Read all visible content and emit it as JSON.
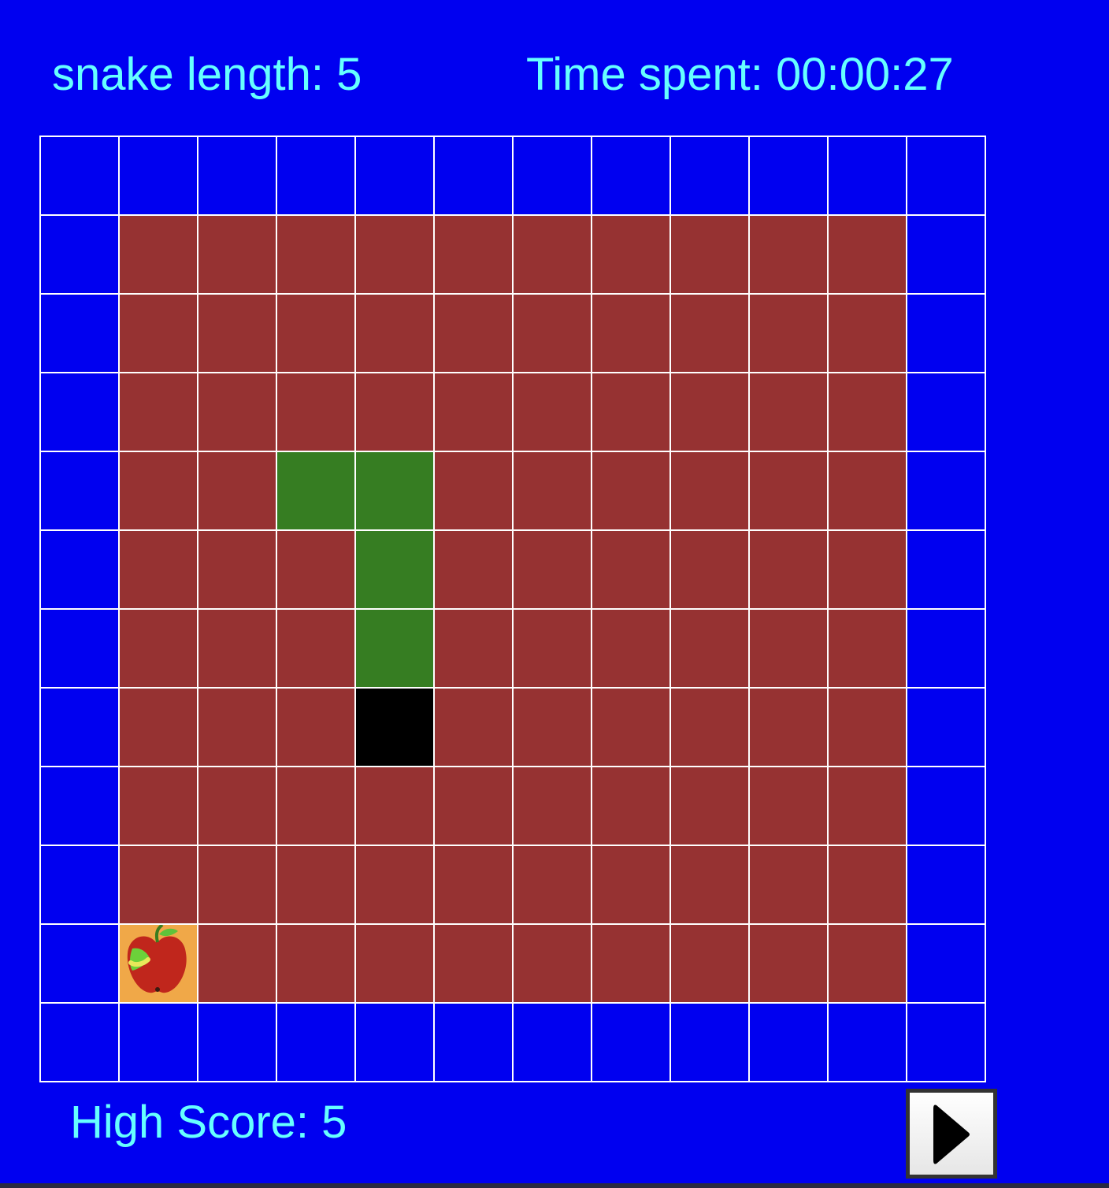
{
  "hud": {
    "snake_length_text": "snake length: 5",
    "time_spent_text": "Time spent: 00:00:27",
    "high_score_text": "High Score: 5"
  },
  "game": {
    "rows": 12,
    "cols": 12,
    "walls": "outer-border",
    "snake": {
      "head": [
        7,
        4
      ],
      "body": [
        [
          6,
          4
        ],
        [
          5,
          4
        ],
        [
          4,
          4
        ],
        [
          4,
          3
        ]
      ]
    },
    "food": {
      "cell": [
        10,
        1
      ],
      "icon": "apple-icon"
    },
    "colors": {
      "background": "#0000F0",
      "wall": "#0000F0",
      "floor": "#963232",
      "snake_body": "#367D22",
      "snake_head": "#000000",
      "food_bg": "#F0A848",
      "grid_line": "#FFFFFF",
      "text": "#66FFFF"
    }
  },
  "controls": {
    "play_icon": "play-icon"
  }
}
